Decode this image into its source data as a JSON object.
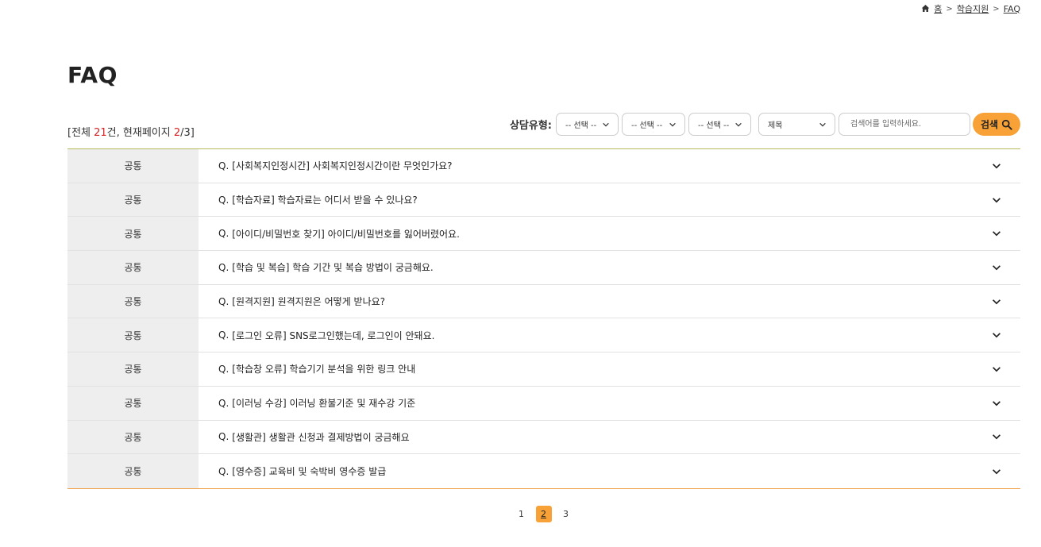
{
  "breadcrumb": {
    "home": "홈",
    "section": "학습지원",
    "current": "FAQ",
    "sep": ">"
  },
  "page_title": "FAQ",
  "count": {
    "prefix": "[전체 ",
    "total": "21",
    "mid": "건, 현재페이지 ",
    "page": "2",
    "suffix": "/3]"
  },
  "filters": {
    "label": "상담유형:",
    "select1": "-- 선택 --",
    "select2": "-- 선택 --",
    "select3": "-- 선택 --",
    "field": "제목",
    "search_placeholder": "검색어를 입력하세요.",
    "search_button": "검색"
  },
  "faq": [
    {
      "category": "공통",
      "prefix": "Q.",
      "question": "[사회복지인정시간] 사회복지인정시간이란 무엇인가요?"
    },
    {
      "category": "공통",
      "prefix": "Q.",
      "question": "[학습자료] 학습자료는 어디서 받을 수 있나요?"
    },
    {
      "category": "공통",
      "prefix": "Q.",
      "question": "[아이디/비밀번호 찾기] 아이디/비밀번호를 잃어버렸어요."
    },
    {
      "category": "공통",
      "prefix": "Q.",
      "question": "[학습 및 복습] 학습 기간 및 복습 방법이 궁금해요."
    },
    {
      "category": "공통",
      "prefix": "Q.",
      "question": "[원격지원] 원격지원은 어떻게 받나요?"
    },
    {
      "category": "공통",
      "prefix": "Q.",
      "question": "[로그인 오류] SNS로그인했는데, 로그인이 안돼요."
    },
    {
      "category": "공통",
      "prefix": "Q.",
      "question": "[학습창 오류] 학습기기 분석을 위한 링크 안내"
    },
    {
      "category": "공통",
      "prefix": "Q.",
      "question": "[이러닝 수강] 이러닝 환불기준 및 재수강 기준"
    },
    {
      "category": "공통",
      "prefix": "Q.",
      "question": "[생활관] 생활관 신청과 결제방법이 궁금해요"
    },
    {
      "category": "공통",
      "prefix": "Q.",
      "question": "[영수증] 교육비 및 숙박비 영수증 발급"
    }
  ],
  "pagination": {
    "pages": [
      "1",
      "2",
      "3"
    ],
    "current": "2"
  },
  "icons": {
    "home": "home-icon",
    "chevron": "chevron-down-icon",
    "search": "search-icon"
  },
  "colors": {
    "accent": "#f7a136",
    "highlight": "#d82121",
    "category_bg": "#eeeeee"
  }
}
